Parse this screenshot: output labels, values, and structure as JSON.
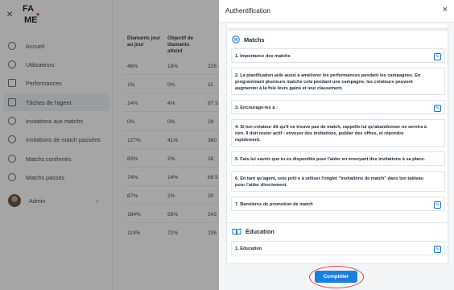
{
  "sidebar": {
    "close_icon": "×",
    "logo": {
      "line1": "FA",
      "line2": "ME",
      "star": "★"
    },
    "items": [
      {
        "label": "Accueil",
        "icon": "home-icon"
      },
      {
        "label": "Utilisateurs",
        "icon": "users-icon"
      },
      {
        "label": "Performances",
        "icon": "chart-icon"
      },
      {
        "label": "Tâches de l'agent",
        "icon": "tasks-icon",
        "active": true
      },
      {
        "label": "Invitations aux matchs",
        "icon": "invite-icon"
      },
      {
        "label": "Invitations de match passées",
        "icon": "history-icon"
      },
      {
        "label": "Matchs confirmés",
        "icon": "check-icon"
      },
      {
        "label": "Matchs passés",
        "icon": "past-icon"
      },
      {
        "label": "Admin",
        "icon": "avatar"
      }
    ],
    "admin_chevron": "›"
  },
  "table": {
    "headers": [
      "Diamants jour au jour",
      "Objectif de diamants atteint",
      ""
    ],
    "rows": [
      [
        "46%",
        "18%",
        "226"
      ],
      [
        "1%",
        "0%",
        "11"
      ],
      [
        "14%",
        "4%",
        "87 3"
      ],
      [
        "0%",
        "0%",
        "29"
      ],
      [
        "127%",
        "41%",
        "380"
      ],
      [
        "83%",
        "2%",
        "28"
      ],
      [
        "74%",
        "14%",
        "68 5"
      ],
      [
        "67%",
        "2%",
        "20"
      ],
      [
        "184%",
        "56%",
        "243"
      ],
      [
        "119%",
        "72%",
        "235"
      ]
    ]
  },
  "drawer": {
    "title": "Authentification",
    "close": "×",
    "matchs": {
      "title": "Matchs",
      "badge": "M",
      "items": [
        "1. Importance des matchs",
        "2. La planification aide aussi à améliorer les performances pendant les campagnes. En programmant plusieurs matchs cela pendant une campagne, les créateurs peuvent augmenter à la fois leurs gains et leur classement.",
        "3. Encourage-les à :",
        "4. Si ton créateur dit qu'il ne trouve pas de match, rappelle-lui qu'abandonner ne servira à rien. Il doit rester actif : envoyer des invitations, publier des offres, et répondre rapidement.",
        "5. Fais-lui savoir que tu es disponible pour l'aider en envoyant des invitations à sa place.",
        "6. En tant qu'agent, sois prêt·e à utiliser l'onglet \"Invitations de match\" dans ton tableau pour l'aider directement.",
        "7. Bannières de promotion de match"
      ]
    },
    "education": {
      "title": "Éducation",
      "items": [
        "1. Éducation"
      ]
    },
    "edit_glyph": "✎",
    "complete_label": "Compléter"
  }
}
